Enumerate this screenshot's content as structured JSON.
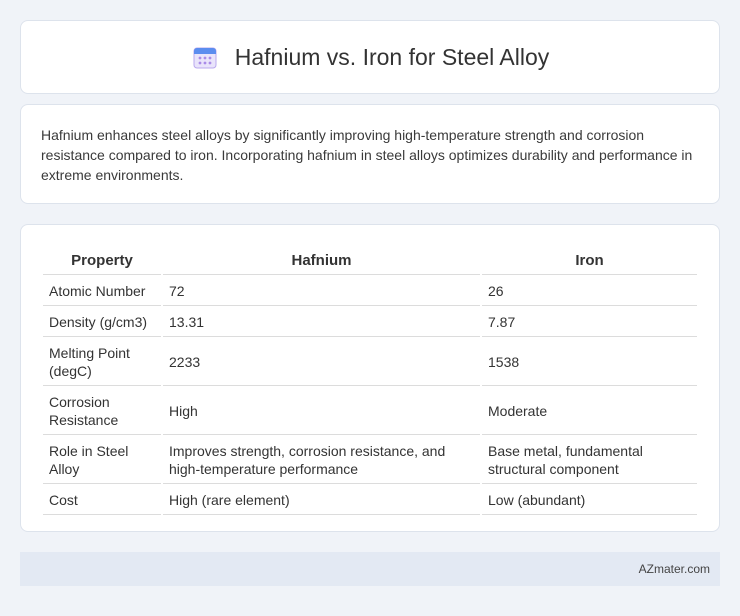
{
  "header": {
    "icon": "calendar-icon",
    "title": "Hafnium vs. Iron for Steel Alloy"
  },
  "description": "Hafnium enhances steel alloys by significantly improving high-temperature strength and corrosion resistance compared to iron. Incorporating hafnium in steel alloys optimizes durability and performance in extreme environments.",
  "table": {
    "headers": [
      "Property",
      "Hafnium",
      "Iron"
    ],
    "rows": [
      [
        "Atomic Number",
        "72",
        "26"
      ],
      [
        "Density (g/cm3)",
        "13.31",
        "7.87"
      ],
      [
        "Melting Point (degC)",
        "2233",
        "1538"
      ],
      [
        "Corrosion Resistance",
        "High",
        "Moderate"
      ],
      [
        "Role in Steel Alloy",
        "Improves strength, corrosion resistance, and high-temperature performance",
        "Base metal, fundamental structural component"
      ],
      [
        "Cost",
        "High (rare element)",
        "Low (abundant)"
      ]
    ]
  },
  "footer": {
    "brand": "AZmater.com"
  },
  "colors": {
    "background": "#f0f3f8",
    "card": "#ffffff",
    "footer": "#e3e9f3",
    "icon_blue": "#5b8def",
    "icon_purple": "#a98be8"
  }
}
